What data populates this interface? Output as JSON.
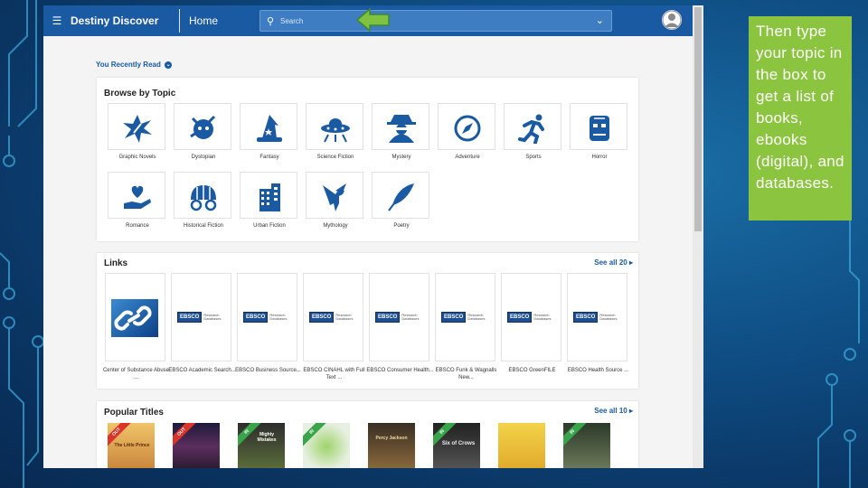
{
  "app": {
    "brand": "Destiny Discover",
    "home_label": "Home",
    "search_placeholder": "Search",
    "menu_icon": "menu-icon",
    "avatar_icon": "user-icon"
  },
  "recent": {
    "label": "You Recently Read"
  },
  "browse": {
    "title": "Browse by Topic",
    "topics": [
      {
        "label": "Graphic Novels",
        "icon": "graphic-novels-icon"
      },
      {
        "label": "Dystopian",
        "icon": "dystopian-icon"
      },
      {
        "label": "Fantasy",
        "icon": "wizard-hat-icon"
      },
      {
        "label": "Science Fiction",
        "icon": "ufo-icon"
      },
      {
        "label": "Mystery",
        "icon": "spy-icon"
      },
      {
        "label": "Adventure",
        "icon": "compass-icon"
      },
      {
        "label": "Sports",
        "icon": "runner-icon"
      },
      {
        "label": "Horror",
        "icon": "monster-icon"
      },
      {
        "label": "Romance",
        "icon": "heart-hand-icon"
      },
      {
        "label": "Historical Fiction",
        "icon": "wagon-icon"
      },
      {
        "label": "Urban Fiction",
        "icon": "building-icon"
      },
      {
        "label": "Mythology",
        "icon": "pegasus-icon"
      },
      {
        "label": "Poetry",
        "icon": "quill-icon"
      }
    ]
  },
  "links": {
    "title": "Links",
    "see_all": "See all 20",
    "items": [
      {
        "label": "Center of Substance Abuse ..."
      },
      {
        "label": "EBSCO Academic Search..."
      },
      {
        "label": "EBSCO Business Source..."
      },
      {
        "label": "EBSCO CINAHL with Full Text ..."
      },
      {
        "label": "EBSCO Consumer Health..."
      },
      {
        "label": "EBSCO Funk & Wagnalls New..."
      },
      {
        "label": "EBSCO GreenFILE"
      },
      {
        "label": "EBSCO Health Source ..."
      }
    ],
    "ebsco_logo": "EBSCO",
    "ebsco_sub": "Research Databases"
  },
  "popular": {
    "title": "Popular Titles",
    "see_all": "See all 10",
    "books": [
      {
        "ribbon": "OUT",
        "title": "The Little Prince"
      },
      {
        "ribbon": "OUT",
        "title": ""
      },
      {
        "ribbon": "IN",
        "title": "Mighty Mistakes"
      },
      {
        "ribbon": "IN",
        "title": ""
      },
      {
        "ribbon": "",
        "title": "Percy Jackson"
      },
      {
        "ribbon": "IN",
        "title": "Six of Crows"
      },
      {
        "ribbon": "",
        "title": ""
      },
      {
        "ribbon": "IN",
        "title": ""
      }
    ]
  },
  "caption": {
    "text": "Then type your topic in the box to get a list of books, ebooks (digital), and databases."
  },
  "colors": {
    "accent": "#1a5aa3",
    "caption_bg": "#8bc53f",
    "ribbon_out": "#d9352b",
    "ribbon_in": "#3aa44a"
  }
}
